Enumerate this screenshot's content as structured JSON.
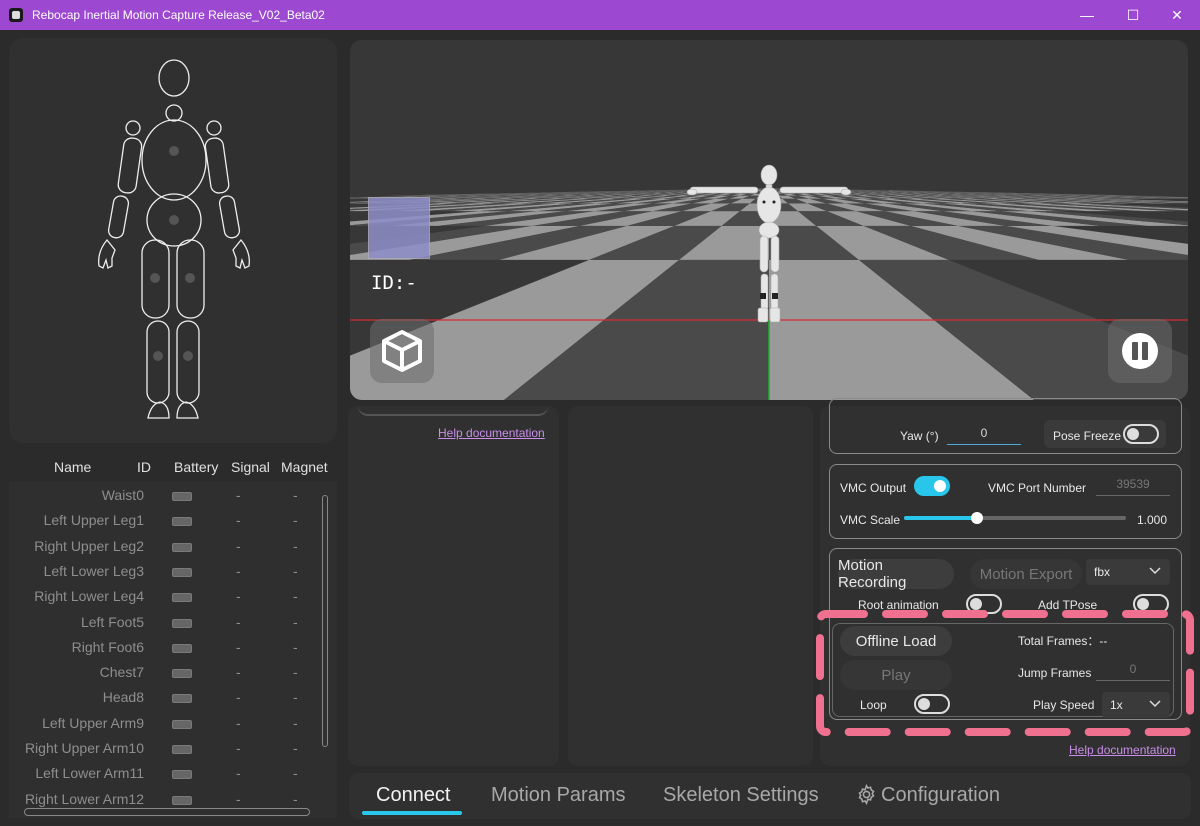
{
  "window": {
    "title": "Rebocap Inertial Motion Capture Release_V02_Beta02",
    "minimize": "—",
    "maximize": "☐",
    "close": "✕"
  },
  "sensor_table": {
    "columns": [
      "Name",
      "ID",
      "Battery",
      "Signal",
      "Magnet"
    ],
    "rows": [
      {
        "name": "Waist0",
        "signal": "-",
        "magnet": "-"
      },
      {
        "name": "Left Upper Leg1",
        "signal": "-",
        "magnet": "-"
      },
      {
        "name": "Right Upper Leg2",
        "signal": "-",
        "magnet": "-"
      },
      {
        "name": "Left Lower Leg3",
        "signal": "-",
        "magnet": "-"
      },
      {
        "name": "Right Lower Leg4",
        "signal": "-",
        "magnet": "-"
      },
      {
        "name": "Left Foot5",
        "signal": "-",
        "magnet": "-"
      },
      {
        "name": "Right Foot6",
        "signal": "-",
        "magnet": "-"
      },
      {
        "name": "Chest7",
        "signal": "-",
        "magnet": "-"
      },
      {
        "name": "Head8",
        "signal": "-",
        "magnet": "-"
      },
      {
        "name": "Left Upper Arm9",
        "signal": "-",
        "magnet": "-"
      },
      {
        "name": "Right Upper Arm10",
        "signal": "-",
        "magnet": "-"
      },
      {
        "name": "Left Lower Arm11",
        "signal": "-",
        "magnet": "-"
      },
      {
        "name": "Right Lower Arm12",
        "signal": "-",
        "magnet": "-"
      }
    ]
  },
  "viewport": {
    "id_label": "ID:-"
  },
  "help": {
    "left_link": "Help documentation",
    "right_link": "Help documentation"
  },
  "pose": {
    "yaw_label": "Yaw (°)",
    "yaw_value": "0",
    "pose_freeze_label": "Pose Freeze",
    "pose_freeze_on": false
  },
  "vmc": {
    "output_label": "VMC Output",
    "output_on": true,
    "port_label": "VMC Port Number",
    "port_value": "39539",
    "scale_label": "VMC Scale",
    "scale_value": "1.000",
    "scale_fraction": 0.33
  },
  "recording": {
    "motion_recording": "Motion Recording",
    "motion_export": "Motion Export",
    "format": "fbx",
    "root_animation_label": "Root animation",
    "root_animation_on": false,
    "add_tpose_label": "Add TPose",
    "add_tpose_on": false
  },
  "playback": {
    "offline_load": "Offline Load",
    "play": "Play",
    "total_frames_label": "Total Frames：--",
    "jump_frames_label": "Jump Frames",
    "jump_frames_value": "0",
    "loop_label": "Loop",
    "loop_on": false,
    "play_speed_label": "Play Speed",
    "play_speed_value": "1x"
  },
  "tabs": [
    {
      "label": "Connect",
      "active": true
    },
    {
      "label": "Motion Params",
      "active": false
    },
    {
      "label": "Skeleton Settings",
      "active": false
    },
    {
      "label": "Configuration",
      "active": false
    }
  ],
  "colors": {
    "titlebar": "#9c48d0",
    "accent": "#29c6ec",
    "link": "#c88ee8",
    "highlight_dash": "#f07090"
  }
}
